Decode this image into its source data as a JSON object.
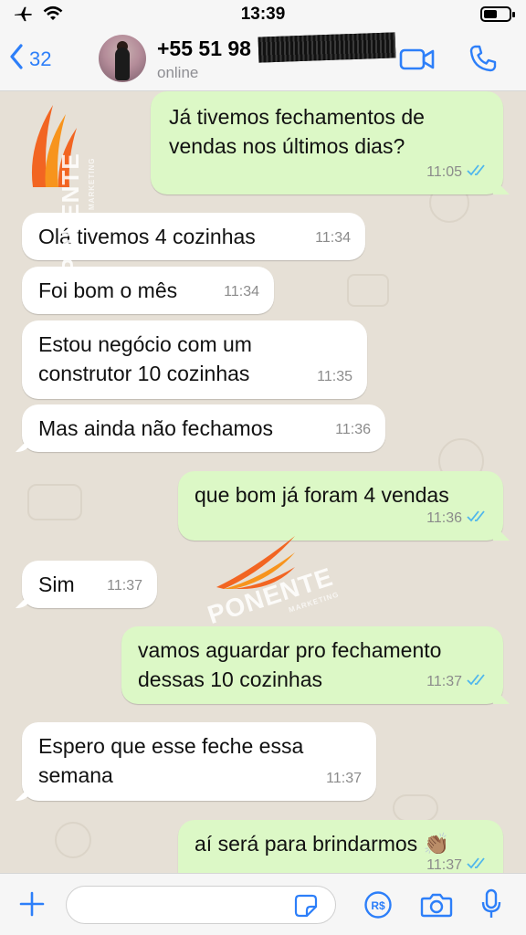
{
  "status_bar": {
    "time": "13:39",
    "icons": [
      "airplane-icon",
      "wifi-icon",
      "battery-icon"
    ],
    "battery_level": 0.55
  },
  "header": {
    "back_count": "32",
    "contact_name": "+55 51 98",
    "contact_status": "online"
  },
  "watermark": {
    "brand": "PONENTE",
    "sub": "MARKETING"
  },
  "messages": [
    {
      "side": "out",
      "lines": [
        "Já tivemos fechamentos de",
        "vendas nos últimos dias?"
      ],
      "time": "11:05",
      "read": true
    },
    {
      "side": "in",
      "lines": [
        "Olá tivemos 4 cozinhas"
      ],
      "time": "11:34"
    },
    {
      "side": "in",
      "lines": [
        "Foi bom o mês"
      ],
      "time": "11:34"
    },
    {
      "side": "in",
      "lines": [
        "Estou negócio com um",
        "construtor 10 cozinhas"
      ],
      "time": "11:35"
    },
    {
      "side": "in",
      "lines": [
        "Mas ainda não fechamos"
      ],
      "time": "11:36"
    },
    {
      "side": "out",
      "lines": [
        "que bom já foram 4 vendas"
      ],
      "time": "11:36",
      "read": true
    },
    {
      "side": "in",
      "lines": [
        "Sim"
      ],
      "time": "11:37"
    },
    {
      "side": "out",
      "lines": [
        "vamos aguardar pro fechamento",
        "dessas 10 cozinhas"
      ],
      "time": "11:37",
      "read": true
    },
    {
      "side": "in",
      "lines": [
        "Espero que esse feche essa",
        "semana"
      ],
      "time": "11:37"
    },
    {
      "side": "out",
      "lines": [
        "aí será para brindarmos 👏🏽"
      ],
      "time": "11:37",
      "read": true
    }
  ],
  "input": {
    "placeholder": ""
  },
  "colors": {
    "accent": "#2d7ff9",
    "outgoing_bubble": "#dcf8c6",
    "incoming_bubble": "#ffffff",
    "read_ticks": "#4fb6ec",
    "logo_orange": "#f26522"
  }
}
